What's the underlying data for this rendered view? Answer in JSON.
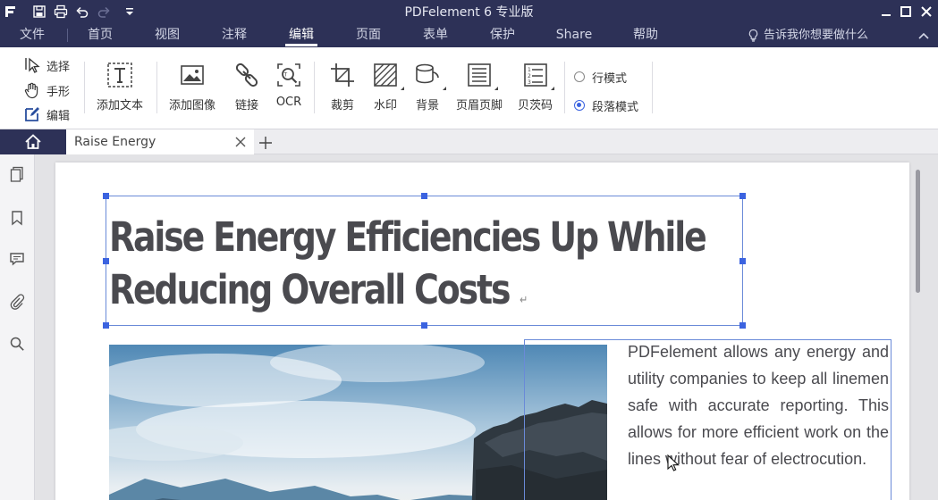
{
  "app": {
    "title": "PDFelement  6 专业版"
  },
  "menu": {
    "items": [
      "文件",
      "首页",
      "视图",
      "注释",
      "编辑",
      "页面",
      "表单",
      "保护",
      "Share",
      "帮助"
    ],
    "active": "编辑",
    "help_tip": "告诉我你想要做什么"
  },
  "ribbon": {
    "modes": [
      "选择",
      "手形",
      "编辑"
    ],
    "tools": {
      "add_text": "添加文本",
      "add_image": "添加图像",
      "link": "链接",
      "ocr": "OCR",
      "crop": "裁剪",
      "watermark": "水印",
      "background": "背景",
      "header_footer": "页眉页脚",
      "bates": "贝茨码"
    },
    "line_mode": "行模式",
    "paragraph_mode": "段落模式",
    "selected_mode": "段落模式"
  },
  "tabs": {
    "doc_title": "Raise Energy"
  },
  "document": {
    "headline_line1": "Raise Energy Efficiencies Up While",
    "headline_line2": "Reducing Overall Costs",
    "return_mark": "↵",
    "body_text": "PDFelement allows any energy and utility companies to keep all linemen safe with accurate reporting. This allows for more efficient work on the lines without fear of electrocution."
  },
  "colors": {
    "chrome": "#2d3157",
    "selection": "#3b63e0",
    "headline": "#4a4a4f"
  }
}
